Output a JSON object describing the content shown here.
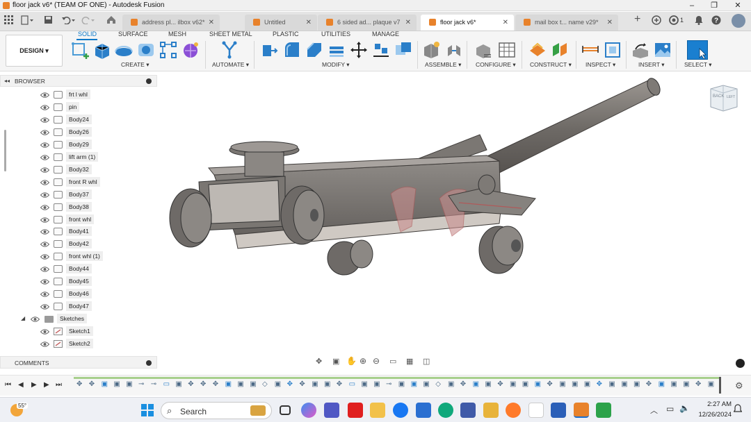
{
  "window": {
    "title": "floor jack v6* (TEAM OF ONE) - Autodesk Fusion",
    "controls": [
      "–",
      "❐",
      "✕"
    ]
  },
  "tabs": [
    {
      "label": "address pl... ilbox v62*",
      "active": false
    },
    {
      "label": "Untitled",
      "active": false
    },
    {
      "label": "6 sided ad... plaque v7",
      "active": false
    },
    {
      "label": "floor jack v6*",
      "active": true
    },
    {
      "label": "mail box t... name v29*",
      "active": false
    }
  ],
  "tabbar_right": {
    "job_count": "1"
  },
  "ribbon": {
    "workspace_button": "DESIGN ▾",
    "tabs": [
      "SOLID",
      "SURFACE",
      "MESH",
      "SHEET METAL",
      "PLASTIC",
      "UTILITIES",
      "MANAGE"
    ],
    "active_tab": "SOLID",
    "groups": [
      {
        "label": "CREATE ▾"
      },
      {
        "label": "AUTOMATE ▾"
      },
      {
        "label": "MODIFY ▾"
      },
      {
        "label": "ASSEMBLE ▾"
      },
      {
        "label": "CONFIGURE ▾"
      },
      {
        "label": "CONSTRUCT ▾"
      },
      {
        "label": "INSPECT ▾"
      },
      {
        "label": "INSERT ▾"
      },
      {
        "label": "SELECT ▾"
      }
    ],
    "accent_color": "#0a78c8"
  },
  "browser": {
    "title": "BROWSER",
    "items": [
      {
        "label": "frt l whl"
      },
      {
        "label": "pin"
      },
      {
        "label": "Body24"
      },
      {
        "label": "Body26"
      },
      {
        "label": "Body29"
      },
      {
        "label": "lift arm (1)"
      },
      {
        "label": "Body32"
      },
      {
        "label": "front  R whl"
      },
      {
        "label": "Body37"
      },
      {
        "label": "Body38"
      },
      {
        "label": "front whl"
      },
      {
        "label": "Body41"
      },
      {
        "label": "Body42"
      },
      {
        "label": "front whl (1)"
      },
      {
        "label": "Body44"
      },
      {
        "label": "Body45"
      },
      {
        "label": "Body46"
      },
      {
        "label": "Body47"
      }
    ],
    "folder": {
      "label": "Sketches"
    },
    "sketches": [
      {
        "label": "Sketch1"
      },
      {
        "label": "Sketch2"
      }
    ]
  },
  "comments": {
    "title": "COMMENTS"
  },
  "viewcube": {
    "back": "BACK",
    "left": "LEFT"
  },
  "taskbar": {
    "weather": "55°",
    "search_placeholder": "Search",
    "time": "2:27 AM",
    "date": "12/26/2024"
  }
}
